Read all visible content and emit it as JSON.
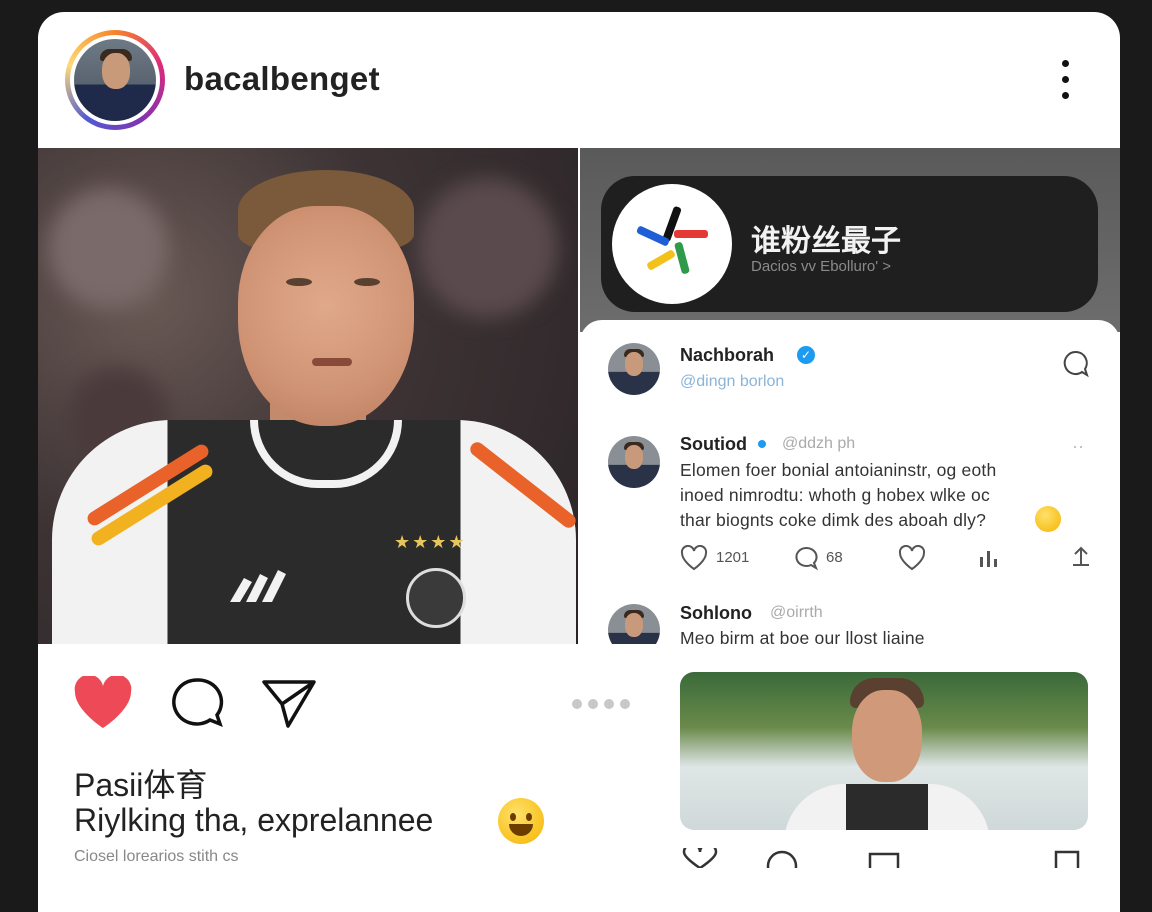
{
  "header": {
    "username": "bacalbenget",
    "menu_icon": "more-vertical-icon"
  },
  "main_photo": {
    "alt": "player portrait",
    "badge_icon": "crest-icon"
  },
  "promo_card": {
    "title": "谁粉丝最子",
    "subtitle": "Dacios vv Ebolluro' >",
    "logo_icon": "pinwheel-logo-icon"
  },
  "feed": {
    "top_post": {
      "name": "Nachborah",
      "handle": "@dingn borlon"
    },
    "post1": {
      "name": "Soutiod",
      "handle": "@ddzh ph",
      "lines": [
        "Elomen foer bonial antoianinstr, og eoth",
        "inoed nimrodtu: whoth g hobex wlke oc",
        "thar biognts coke dimk des aboah dly?"
      ],
      "likes": "1201",
      "comments": "68"
    },
    "post2": {
      "name": "Sohlono",
      "handle": "@oirrth",
      "line": "Meo birm at boe our llost liaine"
    }
  },
  "actions": {
    "like_icon": "heart-icon",
    "comment_icon": "comment-icon",
    "share_icon": "send-icon"
  },
  "caption": {
    "line1": "Pasii体育",
    "line2": "Riylking tha, exprelannee",
    "line3": "Ciosel lorearios stith cs"
  },
  "colors": {
    "heart": "#ed4956",
    "verified": "#1d9bf0",
    "dark_pill": "#1f1f1f"
  }
}
